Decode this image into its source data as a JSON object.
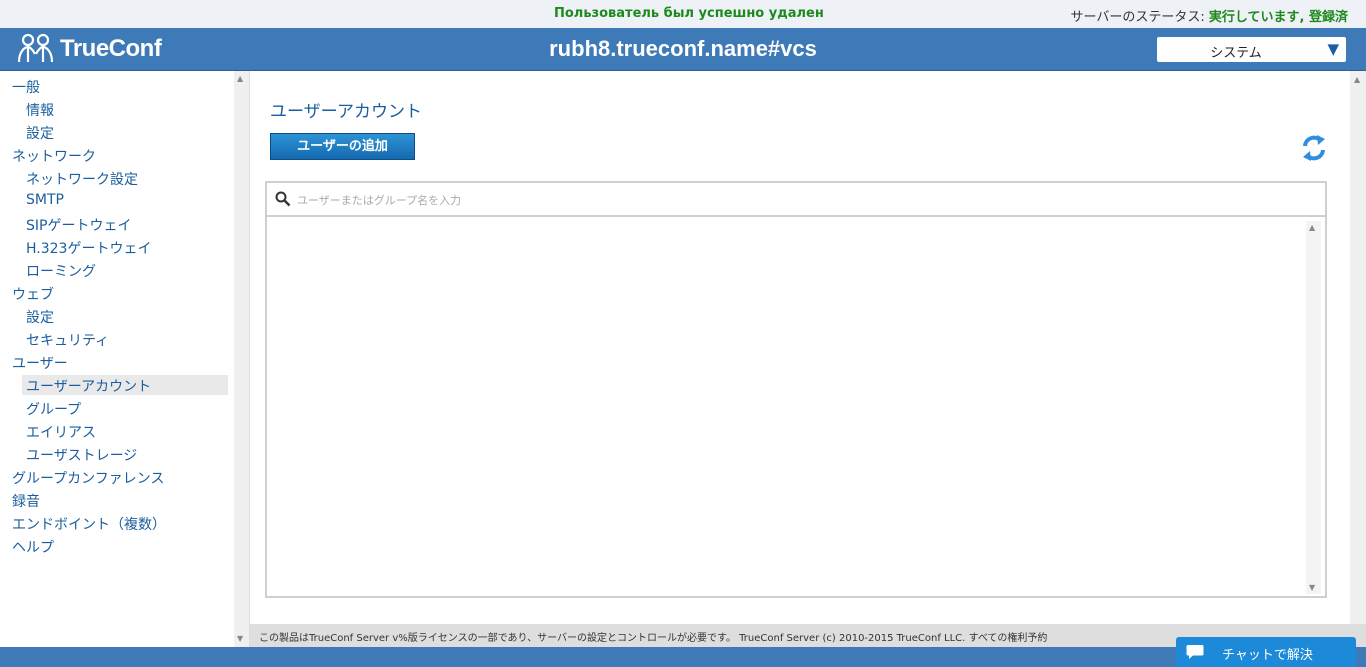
{
  "topbar": {
    "notice": "Пользователь был успешно удален",
    "status_label": "サーバーのステータス: ",
    "status_value": "実行しています, 登録済"
  },
  "header": {
    "logo_text": "TrueConf",
    "server_name": "rubh8.trueconf.name#vcs",
    "system_select": "システム"
  },
  "sidebar": {
    "items": [
      {
        "label": "一般"
      },
      {
        "label": "情報"
      },
      {
        "label": "設定"
      },
      {
        "label": "ネットワーク"
      },
      {
        "label": "ネットワーク設定"
      },
      {
        "label": "SMTP"
      },
      {
        "label": "SIPゲートウェイ"
      },
      {
        "label": "H.323ゲートウェイ"
      },
      {
        "label": "ローミング"
      },
      {
        "label": "ウェブ"
      },
      {
        "label": "設定"
      },
      {
        "label": "セキュリティ"
      },
      {
        "label": "ユーザー"
      },
      {
        "label": "ユーザーアカウント"
      },
      {
        "label": "グループ"
      },
      {
        "label": "エイリアス"
      },
      {
        "label": "ユーザストレージ"
      },
      {
        "label": "グループカンファレンス"
      },
      {
        "label": "録音"
      },
      {
        "label": "エンドボイント（複数）"
      },
      {
        "label": "ヘルプ"
      }
    ]
  },
  "main": {
    "title": "ユーザーアカウント",
    "add_user_label": "ユーザーの追加",
    "search_placeholder": "ユーザーまたはグループ名を入力"
  },
  "footer": {
    "text": "この製品はTrueConf Server v%版ライセンスの一部であり、サーバーの設定とコントロールが必要です。 TrueConf Server (c) 2010-2015 TrueConf LLC. すべての権利予約"
  },
  "chat": {
    "label": "チャットで解決"
  },
  "colors": {
    "header_blue": "#3e79b8",
    "success_green": "#1e8a1e",
    "link_blue": "#1a5e9e",
    "chat_blue": "#1c8ad8"
  }
}
